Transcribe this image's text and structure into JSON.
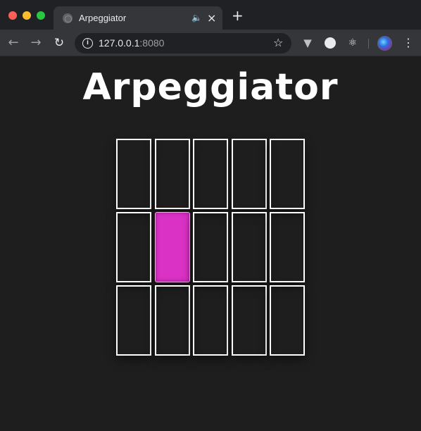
{
  "browser": {
    "tab": {
      "title": "Arpeggiator"
    },
    "address": {
      "host": "127.0.0.1",
      "port": ":8080"
    },
    "icons": {
      "close": "×",
      "new_tab": "+",
      "back": "←",
      "forward": "→",
      "reload": "↻",
      "info": "i",
      "star": "☆",
      "extension_v": "▼",
      "react": "⚛",
      "menu": "⋮",
      "audio": "🔈"
    }
  },
  "page": {
    "title": "Arpeggiator",
    "grid": {
      "columns": 5,
      "rows": [
        [
          false,
          false,
          false,
          false,
          false
        ],
        [
          false,
          true,
          false,
          false,
          false
        ],
        [
          false,
          false,
          false,
          false,
          false
        ]
      ],
      "active_color": "#d932c4",
      "border_color": "#ffffff"
    }
  },
  "colors": {
    "background": "#1e1e1e",
    "tabbar": "#202124",
    "toolbar": "#35363a"
  }
}
